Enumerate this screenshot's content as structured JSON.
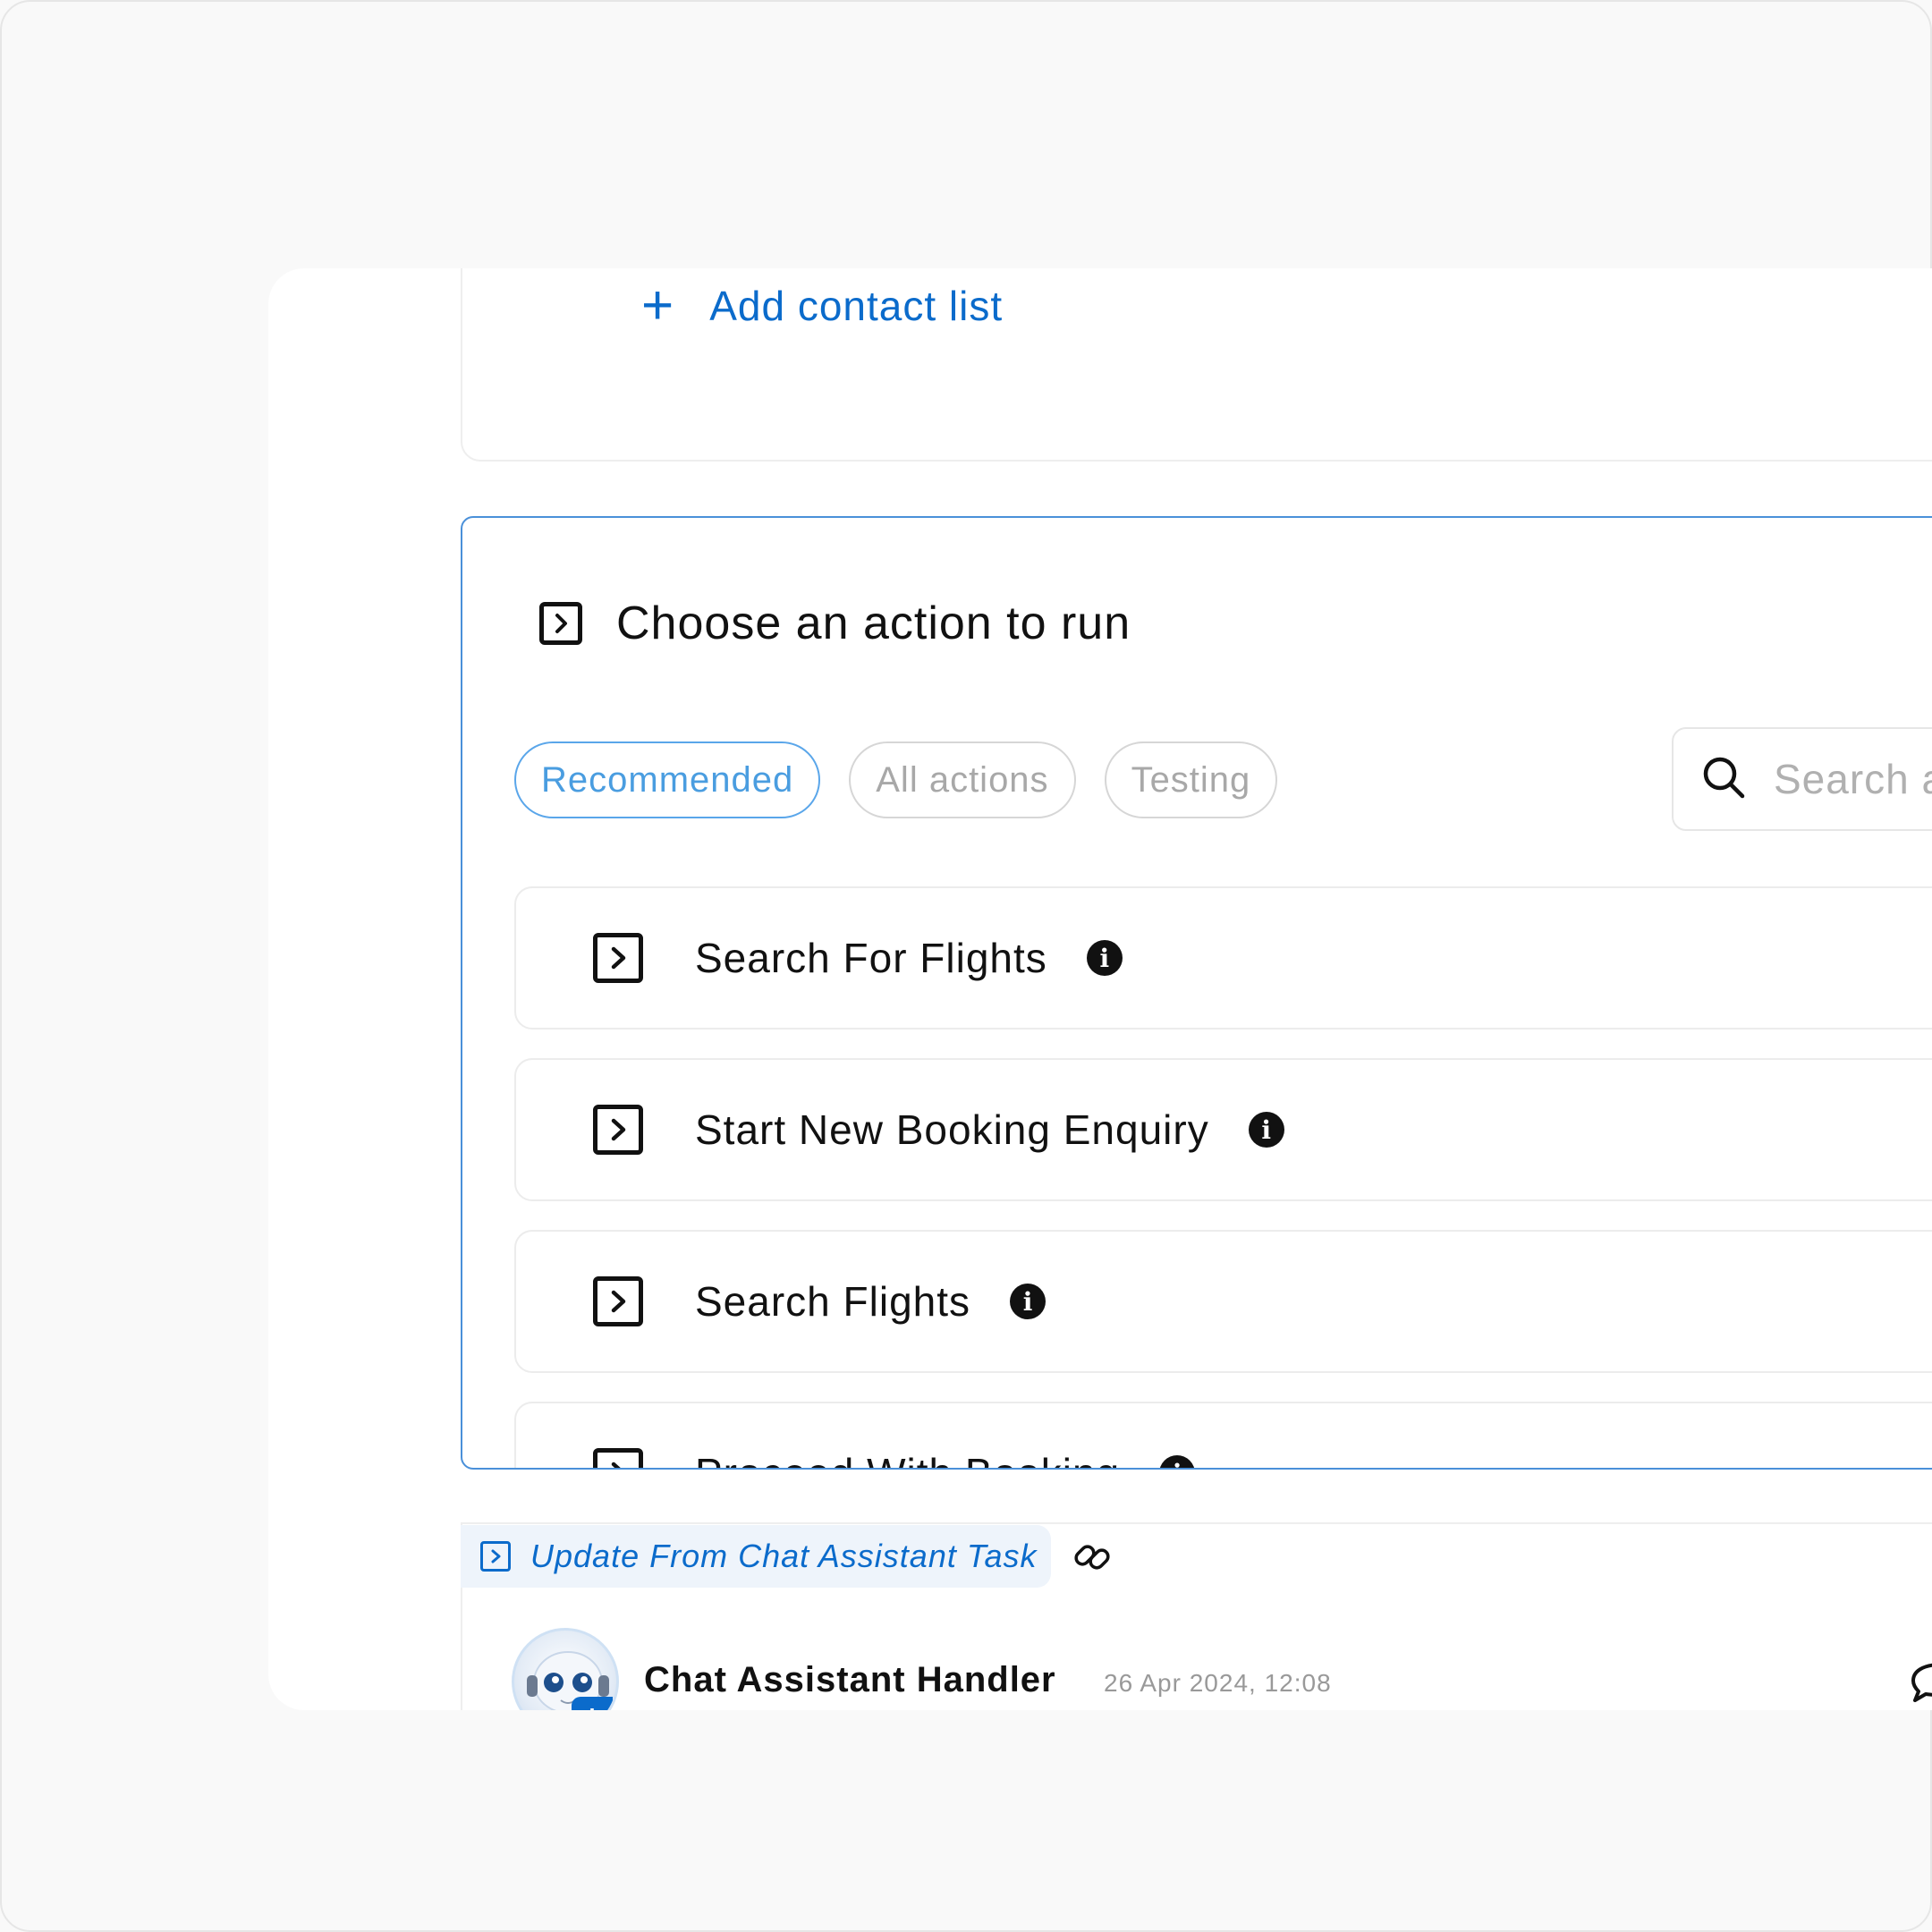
{
  "contact_section": {
    "add_label": "Add contact list",
    "add_icon": "plus-icon"
  },
  "action_panel": {
    "title": "Choose an action to run",
    "title_icon": "action-square-icon",
    "tabs": [
      {
        "label": "Recommended",
        "active": true
      },
      {
        "label": "All actions",
        "active": false
      },
      {
        "label": "Testing",
        "active": false
      }
    ],
    "search": {
      "placeholder": "Search a",
      "icon": "search-icon"
    },
    "actions": [
      {
        "label": "Search For Flights",
        "icon": "action-square-icon",
        "info_icon": "info-icon"
      },
      {
        "label": "Start New Booking Enquiry",
        "icon": "action-square-icon",
        "info_icon": "info-icon"
      },
      {
        "label": "Search Flights",
        "icon": "action-square-icon",
        "info_icon": "info-icon"
      },
      {
        "label": "Proceed With Booking",
        "icon": "action-square-icon",
        "info_icon": "info-icon"
      }
    ]
  },
  "task": {
    "label": "Update From Chat Assistant Task",
    "icon": "action-square-icon",
    "link_icon": "link-icon"
  },
  "message": {
    "sender": "Chat Assistant Handler",
    "timestamp": "26 Apr 2024, 12:08",
    "avatar": "robot-avatar",
    "reply_icon": "comment-icon"
  },
  "colors": {
    "accent": "#0b6bcb",
    "active_tab": "#4a9de0",
    "panel_border": "#4a90d9"
  }
}
